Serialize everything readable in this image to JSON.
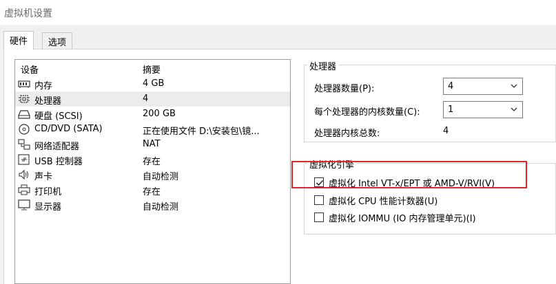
{
  "window": {
    "title": "虚拟机设置"
  },
  "tabs": [
    {
      "label": "硬件",
      "active": true
    },
    {
      "label": "选项",
      "active": false
    }
  ],
  "device_list": {
    "headers": {
      "device": "设备",
      "summary": "摘要"
    },
    "rows": [
      {
        "icon": "memory-icon",
        "device": "内存",
        "summary": "4 GB"
      },
      {
        "icon": "cpu-icon",
        "device": "处理器",
        "summary": "4",
        "selected": true
      },
      {
        "icon": "hard-disk-icon",
        "device": "硬盘 (SCSI)",
        "summary": "200 GB"
      },
      {
        "icon": "cd-dvd-icon",
        "device": "CD/DVD (SATA)",
        "summary": "正在使用文件 D:\\安装包\\镜..."
      },
      {
        "icon": "network-icon",
        "device": "网络适配器",
        "summary": "NAT"
      },
      {
        "icon": "usb-icon",
        "device": "USB 控制器",
        "summary": "存在"
      },
      {
        "icon": "speaker-icon",
        "device": "声卡",
        "summary": "自动检测"
      },
      {
        "icon": "printer-icon",
        "device": "打印机",
        "summary": "存在"
      },
      {
        "icon": "monitor-icon",
        "device": "显示器",
        "summary": "自动检测"
      }
    ]
  },
  "processor": {
    "group_title": "处理器",
    "count_label": "处理器数量(P):",
    "count_value": "4",
    "cores_label": "每个处理器的内核数量(C):",
    "cores_value": "1",
    "total_label": "处理器内核总数:",
    "total_value": "4"
  },
  "virtualization": {
    "group_title": "虚拟化引擎",
    "options": [
      {
        "label": "虚拟化 Intel VT-x/EPT 或 AMD-V/RVI(V)",
        "checked": true
      },
      {
        "label": "虚拟化 CPU 性能计数器(U)",
        "checked": false
      },
      {
        "label": "虚拟化 IOMMU (IO 内存管理单元)(I)",
        "checked": false
      }
    ]
  },
  "colors": {
    "highlight": "#e0262b",
    "selected_row": "#ececec"
  }
}
